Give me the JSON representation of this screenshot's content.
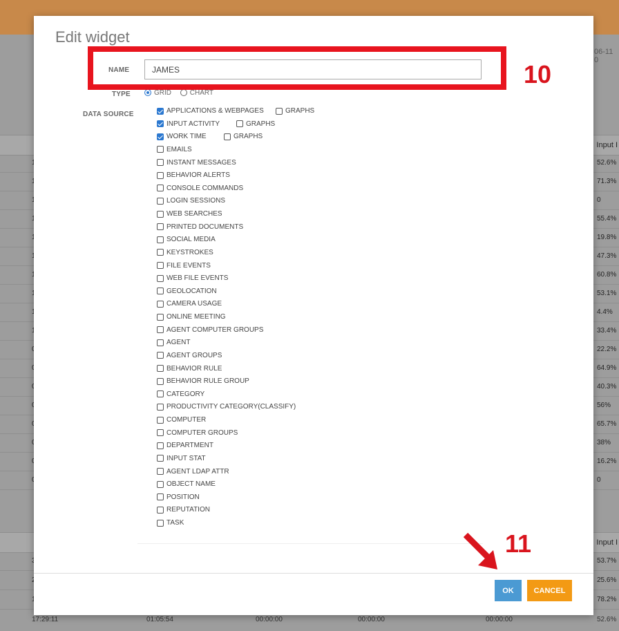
{
  "background": {
    "date_fragment": "06-11 0",
    "header_label": "Input I",
    "top_rows": [
      {
        "left": "1",
        "right": "52.6%"
      },
      {
        "left": "1",
        "right": "71.3%"
      },
      {
        "left": "1",
        "right": "0"
      },
      {
        "left": "1",
        "right": "55.4%"
      },
      {
        "left": "1",
        "right": "19.8%"
      },
      {
        "left": "1",
        "right": "47.3%"
      },
      {
        "left": "1",
        "right": "60.8%"
      },
      {
        "left": "1",
        "right": "53.1%"
      },
      {
        "left": "1",
        "right": "4.4%"
      },
      {
        "left": "1",
        "right": "33.4%"
      },
      {
        "left": "0",
        "right": "22.2%"
      },
      {
        "left": "0",
        "right": "64.9%"
      },
      {
        "left": "0",
        "right": "40.3%"
      },
      {
        "left": "0",
        "right": "56%"
      },
      {
        "left": "0",
        "right": "65.7%"
      },
      {
        "left": "0",
        "right": "38%"
      },
      {
        "left": "0",
        "right": "16.2%"
      },
      {
        "left": "0",
        "right": "0"
      }
    ],
    "bottom_header_label": "Input I",
    "bottom_rows": [
      {
        "left": "3",
        "right": "53.7%"
      },
      {
        "left": "2",
        "right": "25.6%"
      },
      {
        "left": "1",
        "right": "78.2%"
      }
    ],
    "last_row": [
      "17:29:11",
      "01:05:54",
      "00:00:00",
      "00:00:00",
      "00:00:00",
      "52.6%"
    ]
  },
  "modal": {
    "title": "Edit widget",
    "name_label": "NAME",
    "name_value": "JAMES",
    "type_label": "TYPE",
    "type_options": [
      "GRID",
      "CHART"
    ],
    "type_selected": "GRID",
    "data_source_label": "DATA SOURCE",
    "data_sources": [
      {
        "label": "APPLICATIONS & WEBPAGES",
        "checked": true,
        "graphs": "GRAPHS"
      },
      {
        "label": "INPUT ACTIVITY",
        "checked": true,
        "graphs": "GRAPHS"
      },
      {
        "label": "WORK TIME",
        "checked": true,
        "graphs": "GRAPHS"
      },
      {
        "label": "EMAILS",
        "checked": false
      },
      {
        "label": "INSTANT MESSAGES",
        "checked": false
      },
      {
        "label": "BEHAVIOR ALERTS",
        "checked": false
      },
      {
        "label": "CONSOLE COMMANDS",
        "checked": false
      },
      {
        "label": "LOGIN SESSIONS",
        "checked": false
      },
      {
        "label": "WEB SEARCHES",
        "checked": false
      },
      {
        "label": "PRINTED DOCUMENTS",
        "checked": false
      },
      {
        "label": "SOCIAL MEDIA",
        "checked": false
      },
      {
        "label": "KEYSTROKES",
        "checked": false
      },
      {
        "label": "FILE EVENTS",
        "checked": false
      },
      {
        "label": "WEB FILE EVENTS",
        "checked": false
      },
      {
        "label": "GEOLOCATION",
        "checked": false
      },
      {
        "label": "CAMERA USAGE",
        "checked": false
      },
      {
        "label": "ONLINE MEETING",
        "checked": false
      },
      {
        "label": "AGENT COMPUTER GROUPS",
        "checked": false
      },
      {
        "label": "AGENT",
        "checked": false
      },
      {
        "label": "AGENT GROUPS",
        "checked": false
      },
      {
        "label": "BEHAVIOR RULE",
        "checked": false
      },
      {
        "label": "BEHAVIOR RULE GROUP",
        "checked": false
      },
      {
        "label": "CATEGORY",
        "checked": false
      },
      {
        "label": "PRODUCTIVITY CATEGORY(CLASSIFY)",
        "checked": false
      },
      {
        "label": "COMPUTER",
        "checked": false
      },
      {
        "label": "COMPUTER GROUPS",
        "checked": false
      },
      {
        "label": "DEPARTMENT",
        "checked": false
      },
      {
        "label": "INPUT STAT",
        "checked": false
      },
      {
        "label": "AGENT LDAP ATTR",
        "checked": false
      },
      {
        "label": "OBJECT NAME",
        "checked": false
      },
      {
        "label": "POSITION",
        "checked": false
      },
      {
        "label": "REPUTATION",
        "checked": false
      },
      {
        "label": "TASK",
        "checked": false
      }
    ],
    "ok_label": "OK",
    "cancel_label": "CANCEL"
  },
  "annotations": {
    "step_name": "10",
    "step_ok": "11"
  },
  "colors": {
    "primary": "#4b9ad3",
    "warning": "#f39a14",
    "annotation": "#e8141e"
  }
}
